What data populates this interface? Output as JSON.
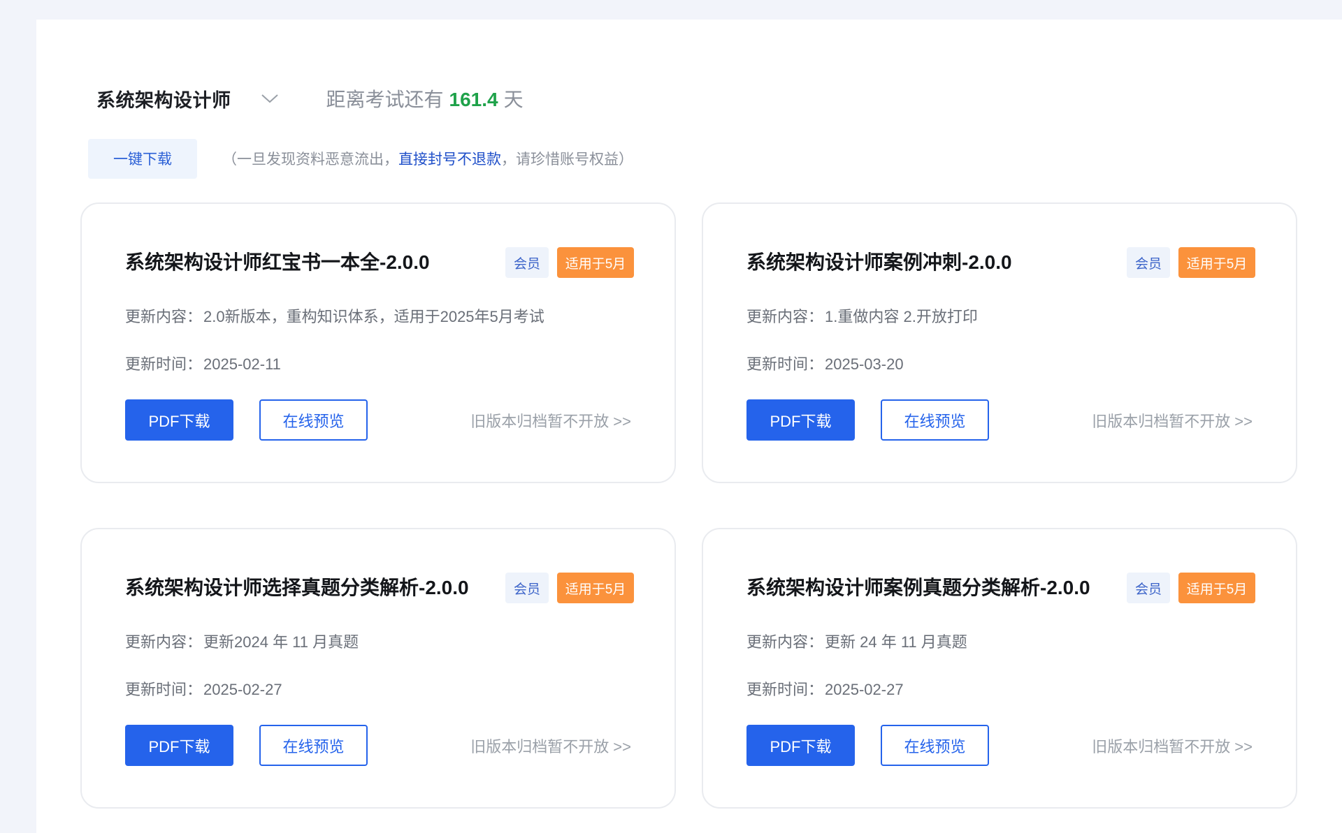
{
  "header": {
    "exam_name": "系统架构设计师",
    "countdown_prefix": "距离考试还有",
    "countdown_days": "161.4",
    "countdown_unit": "天"
  },
  "download": {
    "button_label": "一键下载",
    "warning_start": "（一旦发现资料恶意流出，",
    "warning_link": "直接封号不退款",
    "warning_end": "，请珍惜账号权益）"
  },
  "labels": {
    "update_content": "更新内容：",
    "update_time": "更新时间："
  },
  "cards": [
    {
      "title": "系统架构设计师红宝书一本全-2.0.0",
      "badge_member": "会员",
      "badge_apply": "适用于5月",
      "content": "2.0新版本，重构知识体系，适用于2025年5月考试",
      "time": "2025-02-11",
      "pdf_label": "PDF下载",
      "preview_label": "在线预览",
      "old_version": "旧版本归档暂不开放 >>"
    },
    {
      "title": "系统架构设计师案例冲刺-2.0.0",
      "badge_member": "会员",
      "badge_apply": "适用于5月",
      "content": "1.重做内容 2.开放打印",
      "time": "2025-03-20",
      "pdf_label": "PDF下载",
      "preview_label": "在线预览",
      "old_version": "旧版本归档暂不开放 >>"
    },
    {
      "title": "系统架构设计师选择真题分类解析-2.0.0",
      "badge_member": "会员",
      "badge_apply": "适用于5月",
      "content": "更新2024 年 11 月真题",
      "time": "2025-02-27",
      "pdf_label": "PDF下载",
      "preview_label": "在线预览",
      "old_version": "旧版本归档暂不开放 >>"
    },
    {
      "title": "系统架构设计师案例真题分类解析-2.0.0",
      "badge_member": "会员",
      "badge_apply": "适用于5月",
      "content": "更新 24 年 11 月真题",
      "time": "2025-02-27",
      "pdf_label": "PDF下载",
      "preview_label": "在线预览",
      "old_version": "旧版本归档暂不开放 >>"
    }
  ],
  "colors": {
    "primary": "#2563eb",
    "countdown_green": "#1fa24a",
    "badge_orange": "#fb923c"
  }
}
